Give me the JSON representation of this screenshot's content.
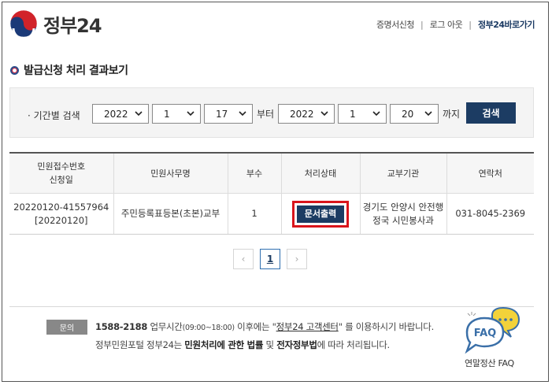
{
  "header": {
    "logo_text": "정부24",
    "nav": [
      {
        "label": "증명서신청"
      },
      {
        "label": "로그 아웃"
      },
      {
        "label": "정부24바로가기"
      }
    ]
  },
  "page_title": "발급신청 처리 결과보기",
  "filter": {
    "label": "기간별 검색",
    "from": {
      "year": "2022",
      "month": "1",
      "day": "17"
    },
    "from_word": "부터",
    "to": {
      "year": "2022",
      "month": "1",
      "day": "20"
    },
    "to_word": "까지",
    "search_label": "검색"
  },
  "table": {
    "headers": [
      "민원접수번호",
      "신청일",
      "민원사무명",
      "부수",
      "처리상태",
      "교부기관",
      "연락처"
    ],
    "rows": [
      {
        "receipt_no": "20220120-41557964",
        "apply_date": "[20220120]",
        "service": "주민등록표등본(초본)교부",
        "copies": "1",
        "status_button": "문서출력",
        "agency_line1": "경기도 안양시 안전행",
        "agency_line2": "정국 시민봉사과",
        "contact": "031-8045-2369"
      }
    ]
  },
  "pagination": {
    "prev": "‹",
    "current": "1",
    "next": "›"
  },
  "footer": {
    "badge": "문의",
    "phone": "1588-2188",
    "hours_label": " 업무시간",
    "hours": "(09:00~18:00)",
    "mid": " 이후에는 \"",
    "center_link": "정부24 고객센터",
    "tail": "\" 를 이용하시기 바랍니다.",
    "line2_a": "정부민원포털 정부24는 ",
    "line2_b": "민원처리에 관한 법률",
    "line2_c": " 및 ",
    "line2_d": "전자정부법",
    "line2_e": "에 따라 처리됩니다.",
    "faq_icon_text": "FAQ",
    "faq_label": "연말정산 FAQ"
  }
}
